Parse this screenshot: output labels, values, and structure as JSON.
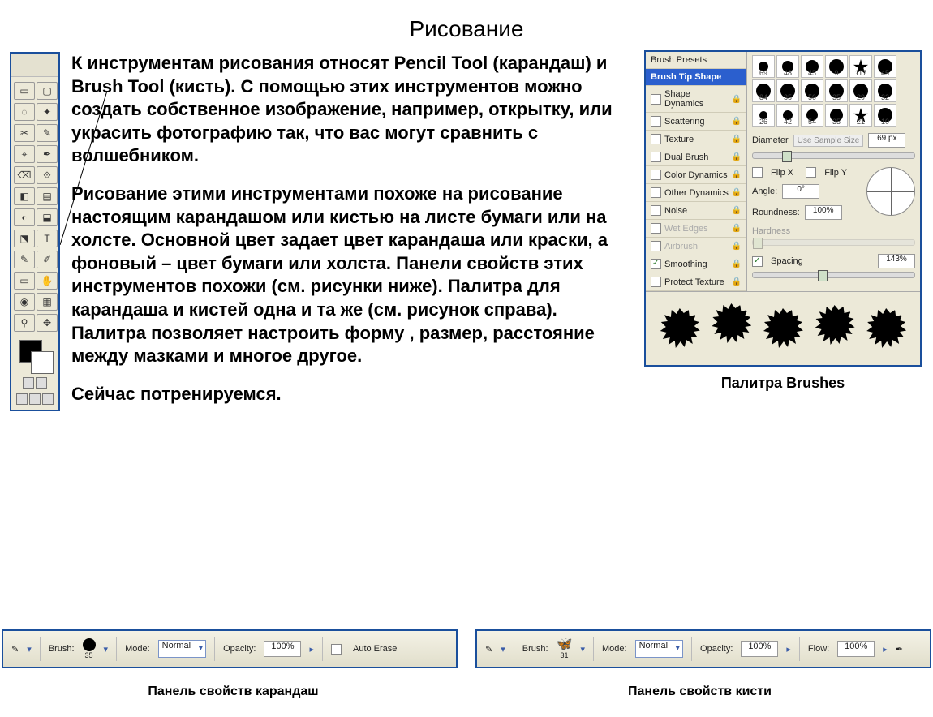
{
  "title": "Рисование",
  "paragraphs": {
    "p1": "К инструментам рисования относят Pencil Tool (карандаш) и Brush Tool (кисть). С помощью этих инструментов можно создать собственное изображение, например, открытку, или украсить фотографию так, что вас могут сравнить с волшебником.",
    "p2": "Рисование этими инструментами похоже на рисование настоящим карандашом или кистью на листе бумаги или на холсте. Основной цвет задает цвет карандаша или краски, а фоновый – цвет бумаги или холста. Панели свойств этих инструментов похожи (см. рисунки ниже). Палитра для карандаша и кистей одна и та же (см. рисунок справа). Палитра позволяет настроить форму , размер, расстояние между мазками и многое другое.",
    "p3": "Сейчас потренируемся."
  },
  "toolbox": {
    "tools": [
      "▭",
      "▢",
      "◌",
      "✦",
      "✂",
      "✎",
      "⌖",
      "✒",
      "⌫",
      "⟐",
      "◧",
      "▤",
      "◐",
      "⬓",
      "⬔",
      "T",
      "✎",
      "✐",
      "▭",
      "✋",
      "◉",
      "▦",
      "⚲",
      "✥"
    ]
  },
  "palette": {
    "caption": "Палитра Brushes",
    "list": [
      {
        "label": "Brush Presets",
        "check": null,
        "selected": false,
        "lock": false
      },
      {
        "label": "Brush Tip Shape",
        "check": null,
        "selected": true,
        "lock": false
      },
      {
        "label": "Shape Dynamics",
        "check": false,
        "selected": false,
        "lock": true
      },
      {
        "label": "Scattering",
        "check": false,
        "selected": false,
        "lock": true
      },
      {
        "label": "Texture",
        "check": false,
        "selected": false,
        "lock": true
      },
      {
        "label": "Dual Brush",
        "check": false,
        "selected": false,
        "lock": true
      },
      {
        "label": "Color Dynamics",
        "check": false,
        "selected": false,
        "lock": true
      },
      {
        "label": "Other Dynamics",
        "check": false,
        "selected": false,
        "lock": true
      },
      {
        "label": "Noise",
        "check": false,
        "selected": false,
        "lock": true
      },
      {
        "label": "Wet Edges",
        "check": false,
        "selected": false,
        "lock": true,
        "disabled": true
      },
      {
        "label": "Airbrush",
        "check": false,
        "selected": false,
        "lock": true,
        "disabled": true
      },
      {
        "label": "Smoothing",
        "check": true,
        "selected": false,
        "lock": true
      },
      {
        "label": "Protect Texture",
        "check": false,
        "selected": false,
        "lock": true
      }
    ],
    "grid_sizes": [
      "69",
      "48",
      "45",
      "9",
      "117",
      "45",
      "84",
      "35",
      "50",
      "35",
      "29",
      "32",
      "26",
      "42",
      "54",
      "35",
      "21",
      "10"
    ],
    "diameter_label": "Diameter",
    "sample_btn": "Use Sample Size",
    "diameter_val": "69 px",
    "flipx": "Flip X",
    "flipy": "Flip Y",
    "angle_label": "Angle:",
    "angle_val": "0°",
    "round_label": "Roundness:",
    "round_val": "100%",
    "hard_label": "Hardness",
    "spacing_label": "Spacing",
    "spacing_val": "143%"
  },
  "bars": {
    "brush_label": "Brush:",
    "mode_label": "Mode:",
    "mode_val": "Normal",
    "opacity_label": "Opacity:",
    "opacity_val": "100%",
    "auto_erase": "Auto Erase",
    "flow_label": "Flow:",
    "flow_val": "100%",
    "pencil_size": "35",
    "brush_size": "31",
    "caption_pencil": "Панель свойств карандаш",
    "caption_brush": "Панель свойств кисти"
  }
}
